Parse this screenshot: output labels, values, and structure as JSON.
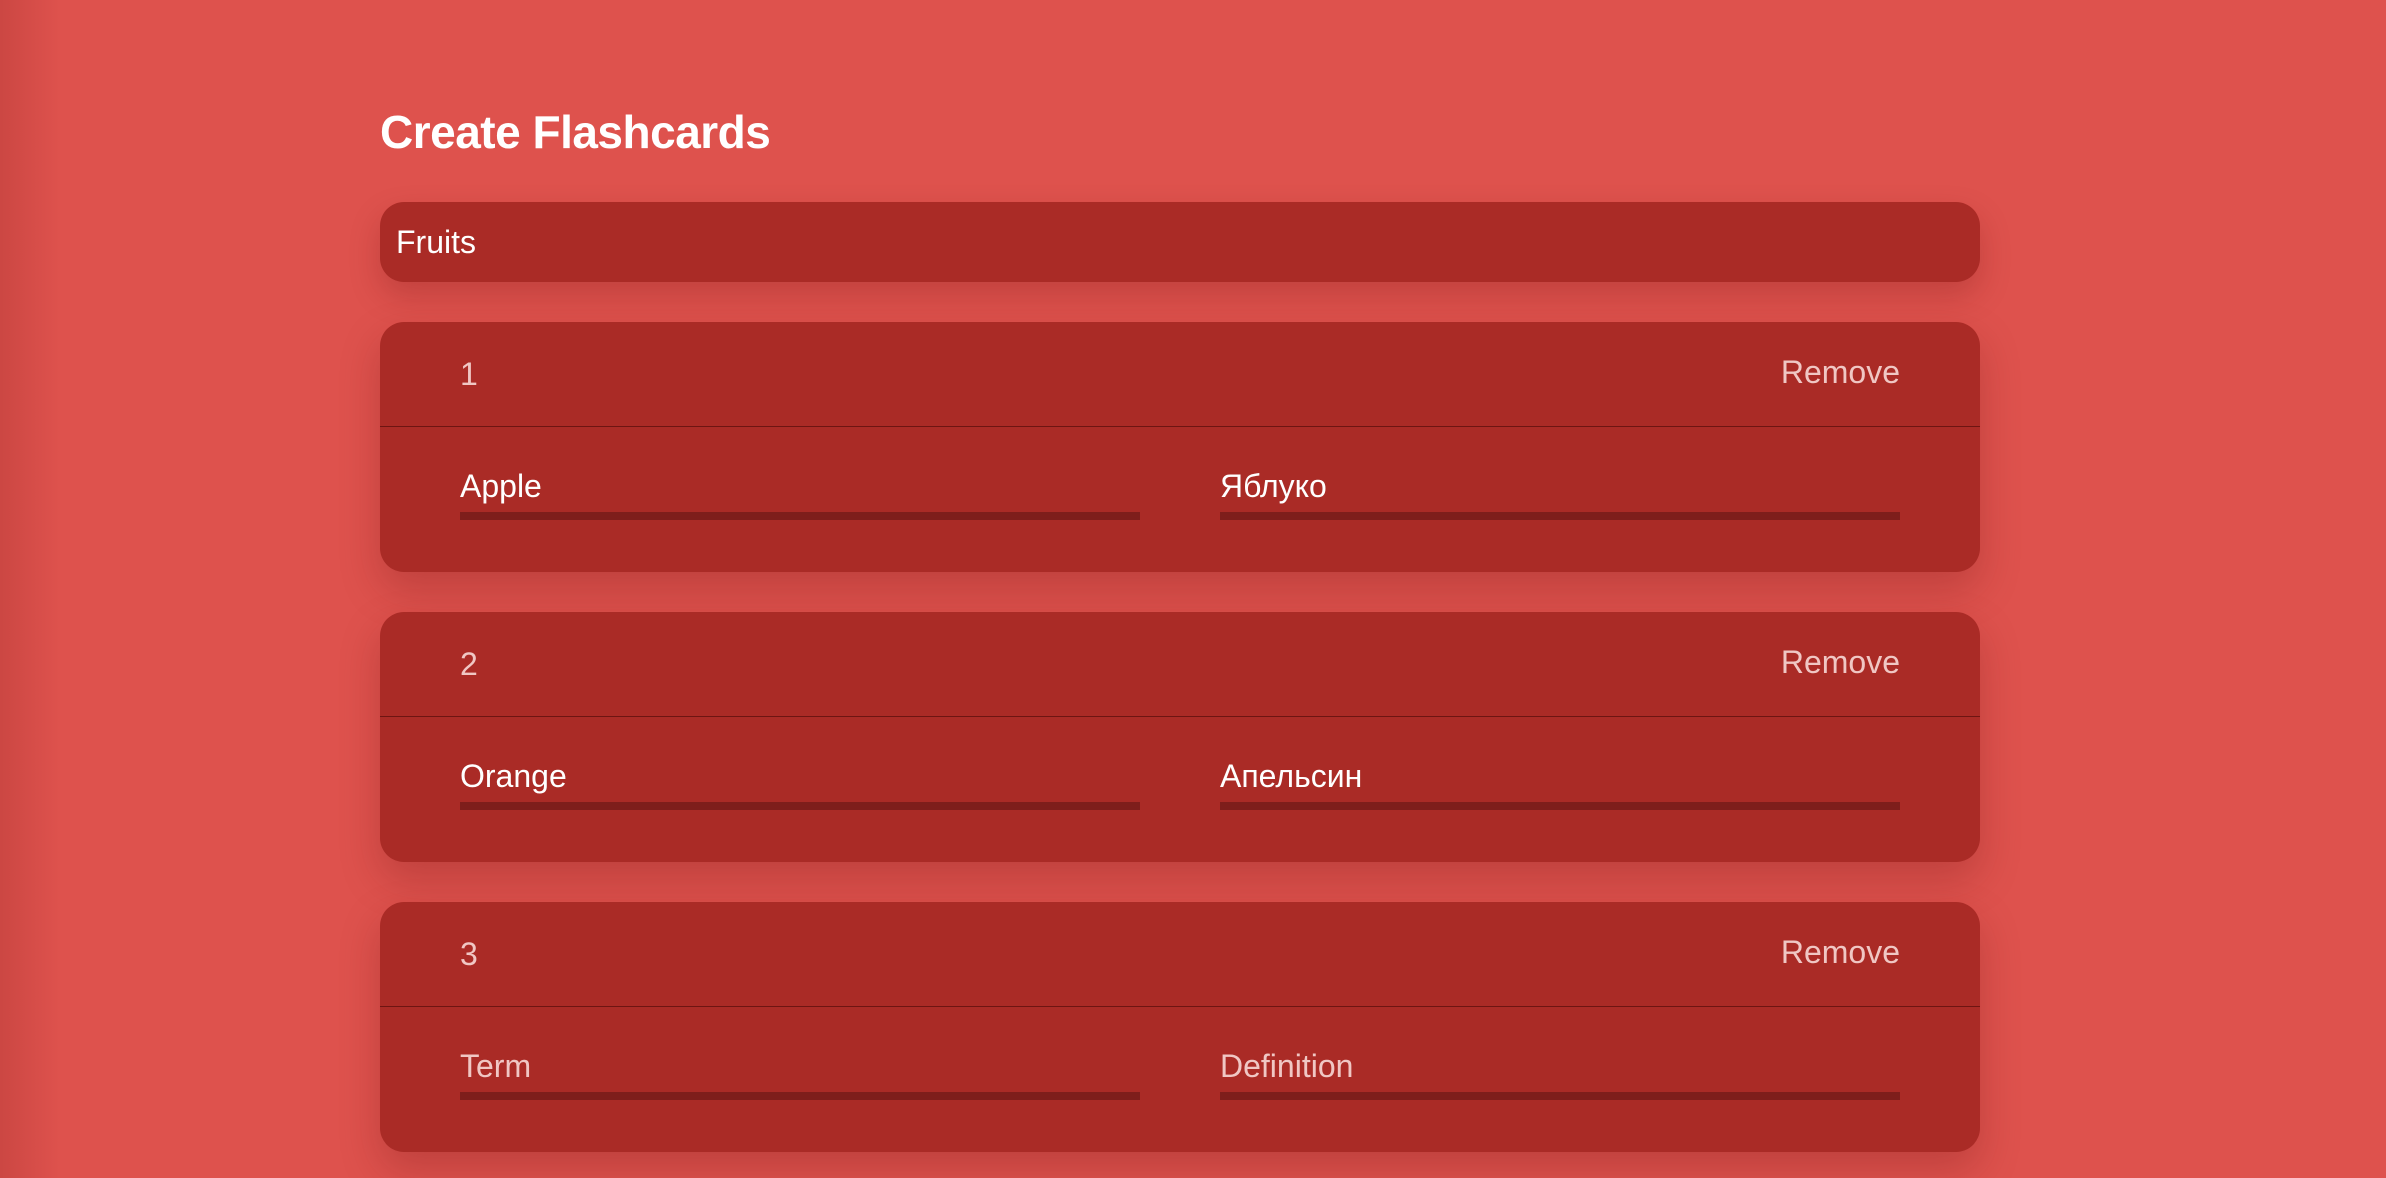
{
  "page": {
    "title": "Create Flashcards"
  },
  "deck": {
    "title_value": "Fruits"
  },
  "cards": [
    {
      "number": "1",
      "remove_label": "Remove",
      "term_value": "Apple",
      "term_placeholder": "Term",
      "definition_value": "Яблуко",
      "definition_placeholder": "Definition"
    },
    {
      "number": "2",
      "remove_label": "Remove",
      "term_value": "Orange",
      "term_placeholder": "Term",
      "definition_value": "Апельсин",
      "definition_placeholder": "Definition"
    },
    {
      "number": "3",
      "remove_label": "Remove",
      "term_value": "",
      "term_placeholder": "Term",
      "definition_value": "",
      "definition_placeholder": "Definition"
    }
  ],
  "colors": {
    "background": "#de524d",
    "surface": "#aa2b26",
    "underline": "#7e1e1b",
    "muted_text": "#f0c7c4"
  }
}
